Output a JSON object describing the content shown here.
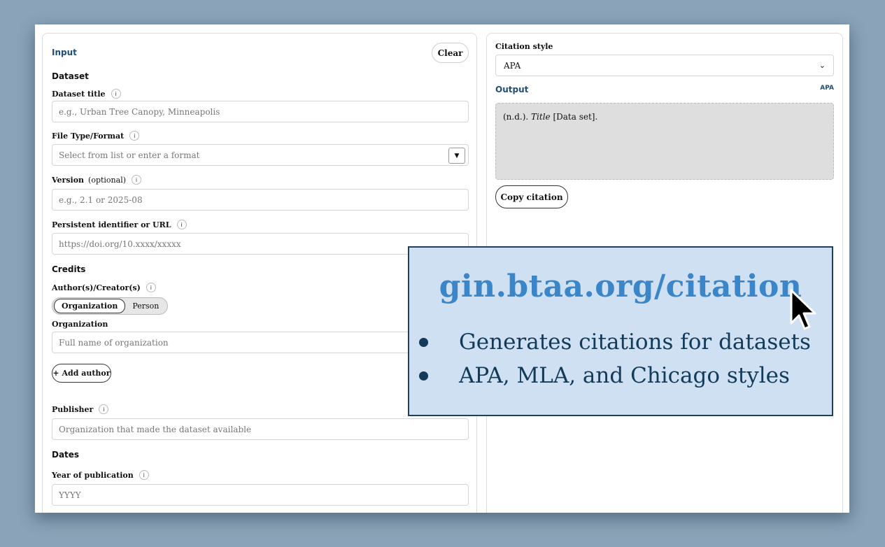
{
  "input_panel": {
    "title": "Input",
    "clear_label": "Clear",
    "dataset_heading": "Dataset",
    "dataset_title": {
      "label": "Dataset title",
      "placeholder": "e.g., Urban Tree Canopy, Minneapolis"
    },
    "file_type": {
      "label": "File Type/Format",
      "placeholder": "Select from list or enter a format"
    },
    "version": {
      "label": "Version",
      "optional": "(optional)",
      "placeholder": "e.g., 2.1 or 2025-08"
    },
    "identifier": {
      "label": "Persistent identifier or URL",
      "placeholder": "https://doi.org/10.xxxx/xxxxx"
    },
    "credits_heading": "Credits",
    "authors": {
      "label": "Author(s)/Creator(s)",
      "toggle": [
        "Organization",
        "Person"
      ],
      "org_label": "Organization",
      "org_placeholder": "Full name of organization",
      "add_author_label": "+ Add author"
    },
    "publisher": {
      "label": "Publisher",
      "placeholder": "Organization that made the dataset available"
    },
    "dates_heading": "Dates",
    "year": {
      "label": "Year of publication",
      "placeholder": "YYYY"
    },
    "info_glyph": "i"
  },
  "output_panel": {
    "style_label": "Citation style",
    "style_value": "APA",
    "output_title": "Output",
    "output_badge": "APA",
    "citation_prefix": "(n.d.). ",
    "citation_title": "Title",
    "citation_suffix": " [Data set].",
    "copy_label": "Copy citation"
  },
  "promo": {
    "url": "gin.btaa.org/citation",
    "bullets": [
      "Generates citations for datasets",
      "APA, MLA, and Chicago styles"
    ]
  },
  "colors": {
    "accent_blue": "#1f4e79",
    "promo_bg": "#cfe0f3",
    "promo_title": "#3a86c8",
    "promo_text": "#123a59"
  }
}
